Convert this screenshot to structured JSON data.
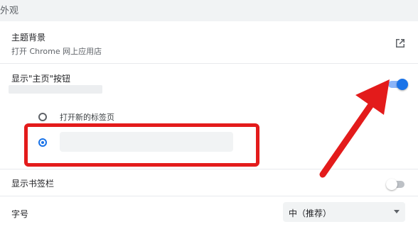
{
  "section": {
    "title": "外观"
  },
  "theme": {
    "label": "主题背景",
    "sublabel": "打开 Chrome 网上应用店",
    "icon": "open-in-new-icon"
  },
  "home_button": {
    "label": "显示\"主页\"按钮",
    "enabled": true,
    "options": [
      {
        "label": "打开新的标签页",
        "selected": false
      },
      {
        "label": "",
        "selected": true
      }
    ]
  },
  "bookmarks_bar": {
    "label": "显示书签栏",
    "enabled": false
  },
  "font_size": {
    "label": "字号",
    "value": "中（推荐）"
  },
  "colors": {
    "toggle_on": "#1a73e8",
    "toggle_track_on": "#8ab4f8",
    "highlight": "#e31b1b"
  }
}
